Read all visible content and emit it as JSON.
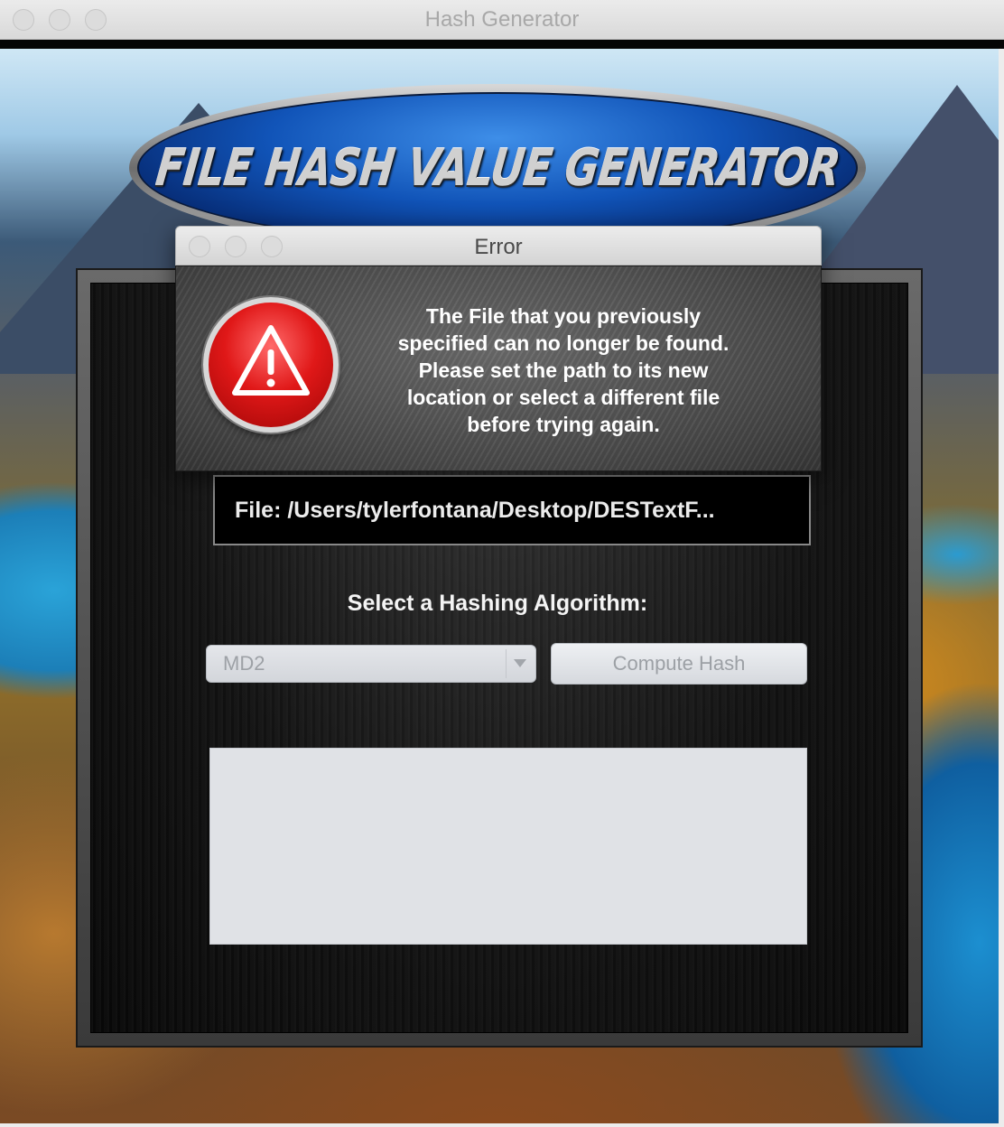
{
  "window": {
    "title": "Hash Generator"
  },
  "banner": {
    "text": "FILE HASH VALUE GENERATOR"
  },
  "dialog": {
    "title": "Error",
    "message": "The File that you previously\nspecified can no longer be found.\nPlease set the path to its new\nlocation or select a different file\nbefore trying again.",
    "icon": "warning-icon"
  },
  "main": {
    "file_label": "File: /Users/tylerfontana/Desktop/DESTextF...",
    "select_label": "Select a Hashing Algorithm:",
    "algorithm_selected": "MD2",
    "compute_button": "Compute Hash",
    "output_text": ""
  },
  "colors": {
    "error_red": "#e01818",
    "banner_blue": "#1154b8",
    "panel_black": "#121212"
  }
}
